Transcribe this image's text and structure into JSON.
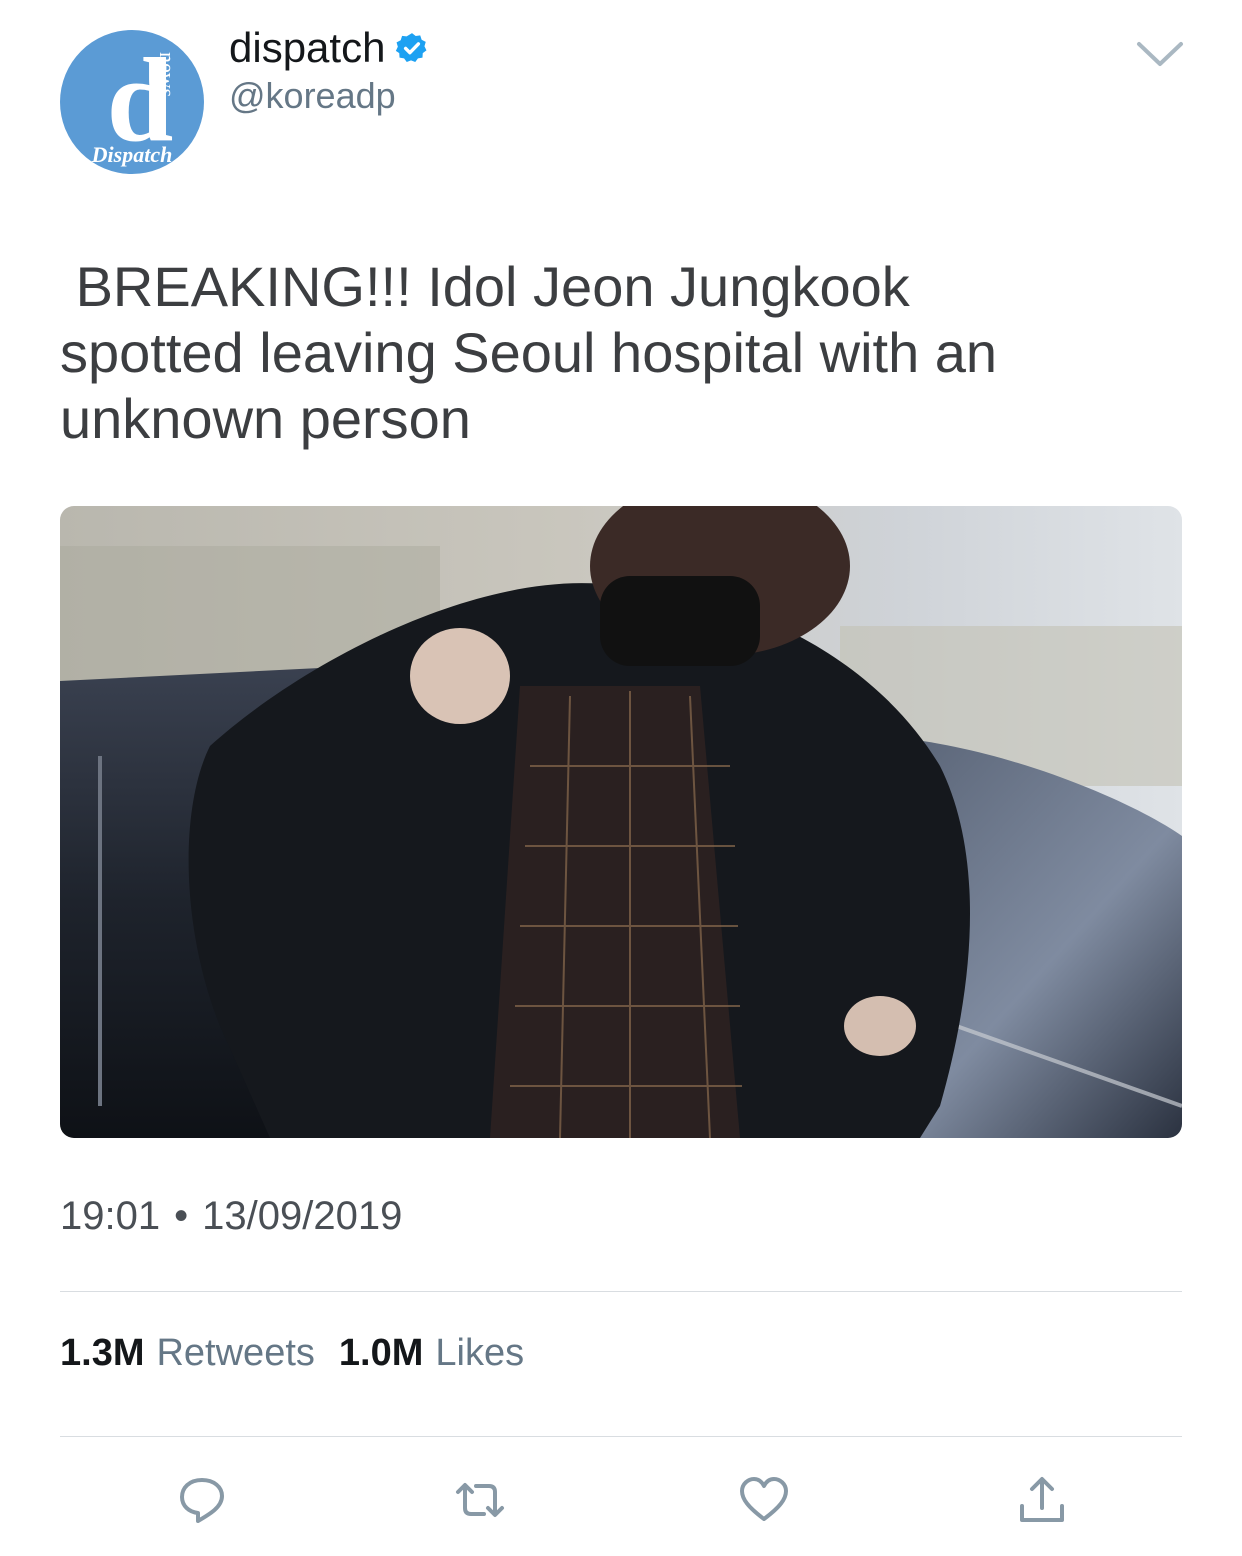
{
  "user": {
    "display_name": "dispatch",
    "handle": "@koreadp",
    "avatar_letter": "d",
    "avatar_side_text": "news",
    "avatar_bottom_text": "Dispatch",
    "avatar_color": "#5b9bd5",
    "verified_color": "#1da1f2"
  },
  "tweet": {
    "text": " BREAKING!!! Idol Jeon Jungkook\nspotted leaving Seoul hospital with an\nunknown person",
    "time": "19:01",
    "separator": "•",
    "date": "13/09/2019"
  },
  "stats": {
    "retweets_count": "1.3M",
    "retweets_label": "Retweets",
    "likes_count": "1.0M",
    "likes_label": "Likes"
  },
  "icons": {
    "chevron": "chevron-down-icon",
    "reply": "reply-icon",
    "retweet": "retweet-icon",
    "like": "heart-icon",
    "share": "share-icon"
  },
  "colors": {
    "icon_gray": "#8899a6",
    "text_dark": "#14171a",
    "text_muted": "#657786"
  }
}
